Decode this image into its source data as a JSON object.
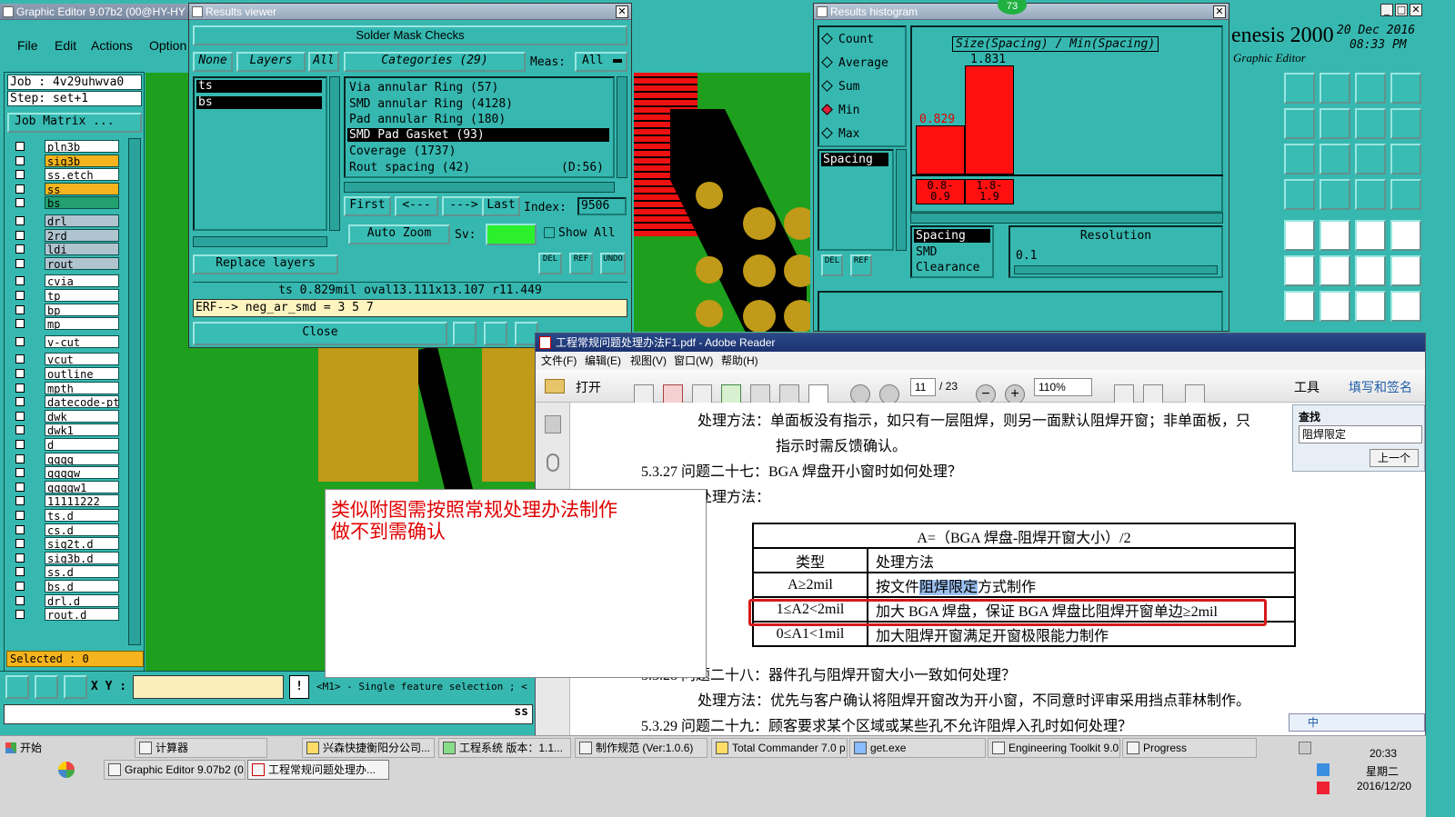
{
  "editor": {
    "title": "Graphic Editor 9.07b2 (00@HY-HY",
    "menu": [
      "File",
      "Edit",
      "Actions",
      "Option"
    ],
    "job_label": "Job : 4v29uhwva0",
    "step_label": "Step: set+1",
    "job_matrix_button": "Job Matrix ...",
    "layers": [
      "pln3b",
      "sig3b",
      "ss.etch",
      "ss",
      "bs",
      "drl",
      "2rd",
      "ldi",
      "rout",
      "cvia",
      "tp",
      "bp",
      "mp",
      "v-cut",
      "vcut",
      "outline",
      "mpth",
      "datecode-pth",
      "dwk",
      "dwk1",
      "d",
      "qqqq",
      "qqqqw",
      "qqqqw1",
      "11111222",
      "ts.d",
      "cs.d",
      "sig2t.d",
      "sig3b.d",
      "ss.d",
      "bs.d",
      "drl.d",
      "rout.d"
    ],
    "selected_status": "Selected : 0",
    "xy_label": "X Y :",
    "hint": "<M1> - Single feature selection ; <",
    "ss_label": "ss"
  },
  "results_viewer": {
    "title": "Results viewer",
    "header": "Solder Mask Checks",
    "none_btn": "None",
    "layers_btn": "Layers",
    "all_btn": "All",
    "categories_btn": "Categories (29)",
    "meas_label": "Meas:",
    "meas_value": "All",
    "layer_list": [
      "ts",
      "bs"
    ],
    "categories": [
      "Via annular Ring (57)",
      "SMD annular Ring (4128)",
      "Pad annular Ring (180)",
      "SMD Pad Gasket (93)",
      "Coverage (1737)",
      "Rout spacing (42)"
    ],
    "cat_extra": "(D:56)",
    "nav": {
      "first": "First",
      "prev": "<---",
      "next": "--->",
      "last": "Last",
      "index_label": "Index:",
      "index_value": "9506"
    },
    "auto_zoom": "Auto Zoom",
    "sv_label": "Sv:",
    "show_all": "Show All",
    "replace_layers": "Replace layers",
    "small_btns": [
      "DEL",
      "REF",
      "UNDO"
    ],
    "info_line": "ts 0.829mil  oval13.111x13.107  r11.449",
    "erf_line": "ERF--> neg_ar_smd = 3 5 7",
    "close_btn": "Close"
  },
  "histogram": {
    "title": "Results histogram",
    "badge": "73",
    "options": [
      "Count",
      "Average",
      "Sum",
      "Min",
      "Max"
    ],
    "selected_option": "Min",
    "list_item": "Spacing",
    "chart_title": "Size(Spacing) / Min(Spacing)",
    "bar_labels": [
      "0.829",
      "1.831"
    ],
    "bin_labels": [
      "0.8-0.9",
      "1.8-1.9"
    ],
    "bin_label_top": [
      "0.8-",
      "1.8-"
    ],
    "bin_label_bottom": [
      "0.9",
      "1.9"
    ],
    "list2": [
      "Spacing",
      "SMD",
      "Clearance"
    ],
    "resolution_label": "Resolution",
    "resolution_value": "0.1",
    "small_btns": [
      "DEL",
      "REF"
    ]
  },
  "genesis": {
    "brand": "enesis 2000",
    "date": "20 Dec 2016",
    "time": "08:33 PM",
    "subtitle": "Graphic Editor"
  },
  "adobe": {
    "title": "工程常规问题处理办法F1.pdf - Adobe Reader",
    "menu": [
      "文件(F)",
      "编辑(E)",
      "视图(V)",
      "窗口(W)",
      "帮助(H)"
    ],
    "open_btn": "打开",
    "page_value": "11",
    "page_total": "/ 23",
    "zoom_value": "110%",
    "tools_btn": "工具",
    "sign_btn": "填写和签名",
    "find_label": "查找",
    "find_value": "阻焊限定",
    "prev_btn": "上一个",
    "doc_lines": {
      "l1": "处理方法：单面板没有指示，如只有一层阻焊，则另一面默认阻焊开窗；非单面板，只",
      "l2": "指示时需反馈确认。",
      "l3": "5.3.27 问题二十七：BGA 焊盘开小窗时如何处理？",
      "l4": "处理方法：",
      "l5": "5.3.28 问题二十八：器件孔与阻焊开窗大小一致如何处理？",
      "l6": "处理方法：优先与客户确认将阻焊开窗改为开小窗，不同意时评审采用挡点菲林制作。",
      "l7": "5.3.29 问题二十九：顾客要求某个区域或某些孔不允许阻焊入孔时如何处理？"
    },
    "table": {
      "title": "A=（BGA 焊盘-阻焊开窗大小）/2",
      "head": [
        "类型",
        "处理方法"
      ],
      "rows": [
        [
          "A≥2mil",
          "按文件阻焊限定方式制作"
        ],
        [
          "1≤A2<2mil",
          "加大 BGA 焊盘，保证 BGA 焊盘比阻焊开窗单边≥2mil"
        ],
        [
          "0≤A1<1mil",
          "加大阻焊开窗满足开窗极限能力制作"
        ]
      ],
      "row1_pre": "按文件",
      "row1_hl": "阻焊限定",
      "row1_post": "方式制作"
    },
    "ime": "中"
  },
  "note": {
    "text1": "类似附图需按照常规处理办法制作",
    "text2": "做不到需确认"
  },
  "taskbar": {
    "start": "开始",
    "row1": [
      "计算器",
      "兴森快捷衡阳分公司...",
      "工程系统  版本：1.1...",
      "制作规范 (Ver:1.0.6)",
      "Total Commander 7.0 p...",
      "get.exe",
      "Engineering Toolkit 9.0...",
      "Progress"
    ],
    "row2": [
      "Graphic Editor 9.07b2 (0...",
      "工程常规问题处理办..."
    ],
    "time": "20:33",
    "weekday": "星期二",
    "date": "2016/12/20"
  }
}
